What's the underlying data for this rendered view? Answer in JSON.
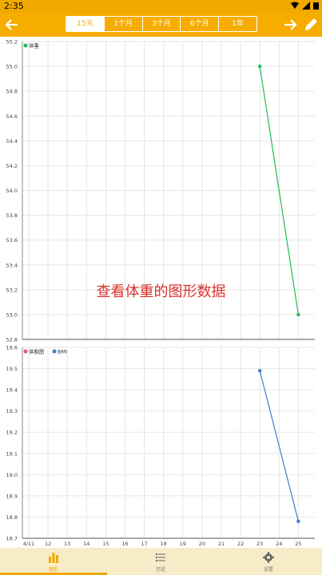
{
  "status": {
    "time": "2:35"
  },
  "appbar": {
    "tabs": [
      {
        "label": "15天",
        "active": true
      },
      {
        "label": "1个月",
        "active": false
      },
      {
        "label": "3个月",
        "active": false
      },
      {
        "label": "6个月",
        "active": false
      },
      {
        "label": "1年",
        "active": false
      }
    ],
    "accent": "#f7ad00"
  },
  "overlay_text": "查看体重的图形数据",
  "chart_data": [
    {
      "type": "line",
      "legend": "top-left",
      "series": [
        {
          "name": "体重",
          "color": "#22bb55",
          "x": [
            "23",
            "25"
          ],
          "values": [
            55.0,
            53.0
          ]
        }
      ],
      "ylim": [
        52.8,
        55.2
      ],
      "yticks": [
        52.8,
        53.0,
        53.2,
        53.4,
        53.6,
        53.8,
        54.0,
        54.2,
        54.4,
        54.6,
        54.8,
        55.0,
        55.2
      ],
      "grid": true
    },
    {
      "type": "line",
      "legend": "top-left",
      "series": [
        {
          "name": "体脂肪",
          "color": "#e05570",
          "x": [],
          "values": []
        },
        {
          "name": "BMI",
          "color": "#3a7fd0",
          "x": [
            "23",
            "25"
          ],
          "values": [
            19.49,
            18.78
          ]
        }
      ],
      "categories": [
        "4/11",
        "12",
        "13",
        "14",
        "15",
        "16",
        "17",
        "18",
        "19",
        "20",
        "21",
        "22",
        "23",
        "24",
        "25"
      ],
      "ylim": [
        18.7,
        19.6
      ],
      "yticks": [
        18.7,
        18.8,
        18.9,
        19.0,
        19.1,
        19.2,
        19.3,
        19.4,
        19.5,
        19.6
      ],
      "grid": true
    }
  ],
  "nav": [
    {
      "label": "图形",
      "icon": "bar-chart-icon",
      "active": true
    },
    {
      "label": "历史",
      "icon": "list-icon",
      "active": false
    },
    {
      "label": "设置",
      "icon": "gear-icon",
      "active": false
    }
  ]
}
